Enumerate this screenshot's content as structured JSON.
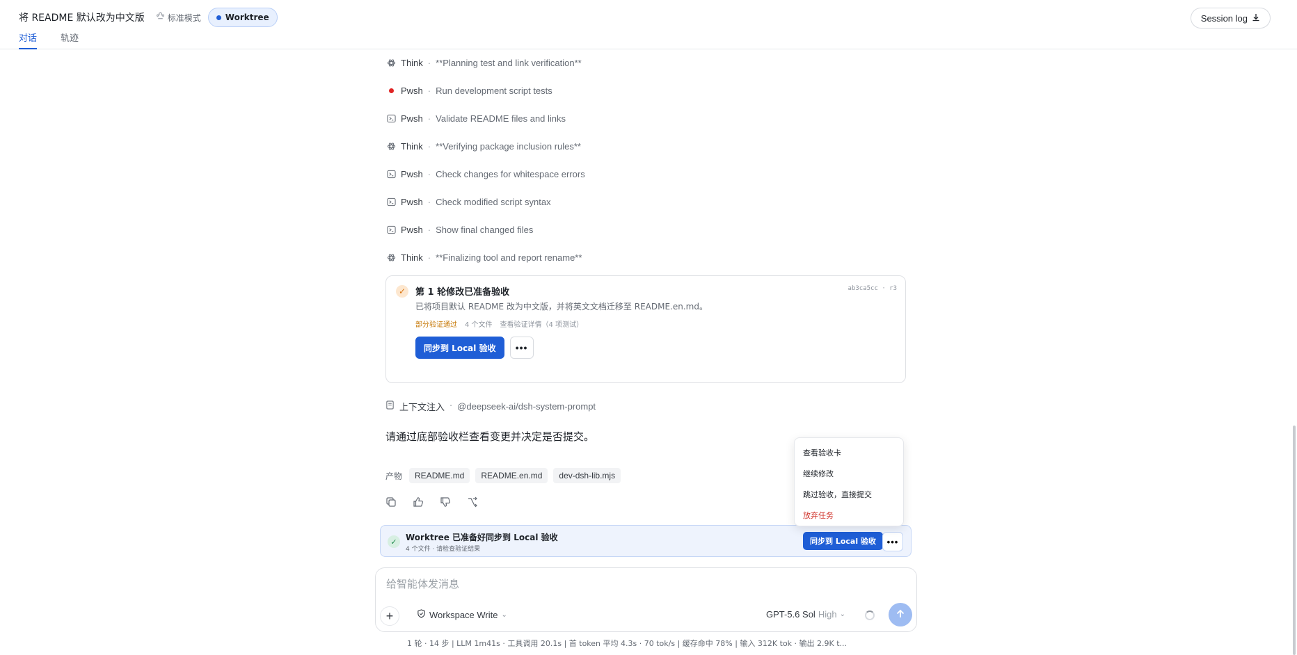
{
  "header": {
    "title": "将 README 默认改为中文版",
    "mode_label": "标准模式",
    "worktree_label": "Worktree",
    "session_log_label": "Session log",
    "tabs": [
      {
        "label": "对话",
        "active": true
      },
      {
        "label": "轨迹",
        "active": false
      }
    ]
  },
  "steps": [
    {
      "icon": "think-icon",
      "kind": "Think",
      "text": "**Planning test and link verification**"
    },
    {
      "icon": "running-dot-icon",
      "kind": "Pwsh",
      "text": "Run development script tests"
    },
    {
      "icon": "terminal-icon",
      "kind": "Pwsh",
      "text": "Validate README files and links"
    },
    {
      "icon": "think-icon",
      "kind": "Think",
      "text": "**Verifying package inclusion rules**"
    },
    {
      "icon": "terminal-icon",
      "kind": "Pwsh",
      "text": "Check changes for whitespace errors"
    },
    {
      "icon": "terminal-icon",
      "kind": "Pwsh",
      "text": "Check modified script syntax"
    },
    {
      "icon": "terminal-icon",
      "kind": "Pwsh",
      "text": "Show final changed files"
    },
    {
      "icon": "think-icon",
      "kind": "Think",
      "text": "**Finalizing tool and report rename**"
    }
  ],
  "step_separator": "·",
  "review_card": {
    "title": "第 1 轮修改已准备验收",
    "hash": "ab3ca5cc · r3",
    "description": "已将项目默认 README 改为中文版，并将英文文档迁移至 README.en.md。",
    "status": "部分验证通过",
    "files": "4 个文件",
    "details": "查看验证详情（4 项测试）",
    "sync_label": "同步到 Local 验收",
    "more_label": "•••"
  },
  "context": {
    "label": "上下文注入",
    "value": "@deepseek-ai/dsh-system-prompt"
  },
  "message": "请通过底部验收栏查看变更并决定是否提交。",
  "artifacts": {
    "label": "产物",
    "files": [
      "README.md",
      "README.en.md",
      "dev-dsh-lib.mjs"
    ]
  },
  "worktree_bar": {
    "title": "Worktree 已准备好同步到 Local 验收",
    "subtitle": "4 个文件 · 请检查验证结果",
    "sync_label": "同步到 Local 验收",
    "more_label": "•••"
  },
  "menu": {
    "items": [
      {
        "label": "查看验收卡",
        "danger": false
      },
      {
        "label": "继续修改",
        "danger": false
      },
      {
        "label": "跳过验收，直接提交",
        "danger": false
      },
      {
        "label": "放弃任务",
        "danger": true
      }
    ]
  },
  "composer": {
    "placeholder": "给智能体发消息",
    "value": "",
    "workspace_label": "Workspace Write",
    "model_label": "GPT-5.6 Sol",
    "model_level": "High"
  },
  "stats": "1 轮 · 14 步  |  LLM 1m41s · 工具调用 20.1s  |  首 token 平均 4.3s · 70 tok/s  |  缓存命中 78%  |  输入 312K tok · 输出 2.9K t...",
  "colors": {
    "accent": "#1f5ed6",
    "warning": "#c77a0a",
    "danger": "#d0342c",
    "running": "#e02424"
  }
}
